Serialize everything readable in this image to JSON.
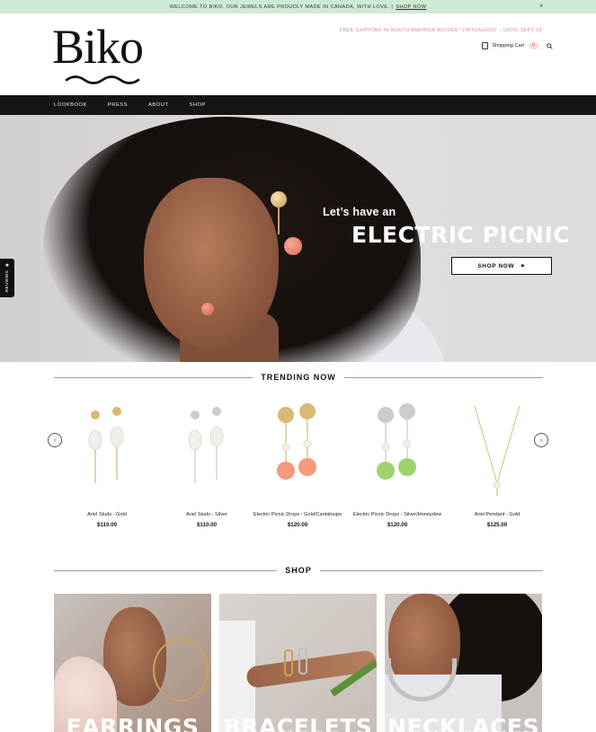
{
  "announcement": {
    "text": "WELCOME TO BIKO. OUR JEWELS ARE PROUDLY MADE IN CANADA, WITH LOVE. |",
    "link": "SHOP NOW",
    "close": "×"
  },
  "header": {
    "logo": "Biko",
    "shipping": "FREE SHIPPING IN NORTH AMERICA W/CODE 'VIRTUALHUG' - UNTIL SEPT 15",
    "cart_label": "Shopping Cart",
    "cart_count": "0"
  },
  "nav": {
    "items": [
      "LOOKBOOK",
      "PRESS",
      "ABOUT",
      "SHOP"
    ]
  },
  "hero": {
    "sub": "Let’s have an",
    "headline": "ELECTRIC PICNIC",
    "button": "SHOP NOW"
  },
  "reviews_tab": {
    "label": "REVIEWS",
    "star": "★"
  },
  "trending": {
    "title": "TRENDING NOW",
    "prev": "‹",
    "next": "›",
    "products": [
      {
        "name": "Ariel Studs - Gold",
        "price": "$110.00",
        "metal": "#d8b56a",
        "stone": "#f2efe8"
      },
      {
        "name": "Ariel Studs - Silver",
        "price": "$110.00",
        "metal": "#c9c9c9",
        "stone": "#f2efe8"
      },
      {
        "name": "Electric Picnic Drops - Gold/Cantaloupe",
        "price": "$120.00",
        "metal": "#d8b56a",
        "stone": "#f39a7a"
      },
      {
        "name": "Electric Picnic Drops - Silver/Honeydew",
        "price": "$120.00",
        "metal": "#c9c9c9",
        "stone": "#9fd36d"
      },
      {
        "name": "Ariel Pendant - Gold",
        "price": "$125.00",
        "metal": "#d8b56a",
        "stone": "#f2efe8"
      }
    ]
  },
  "shop": {
    "title": "SHOP",
    "tiles": [
      {
        "label": "EARRINGS"
      },
      {
        "label": "BRACELETS"
      },
      {
        "label": "NECKLACES"
      }
    ]
  },
  "colors": {
    "announce_bg": "#cfead2",
    "nav_bg": "#151515",
    "shipping_text": "#d58a8a"
  }
}
